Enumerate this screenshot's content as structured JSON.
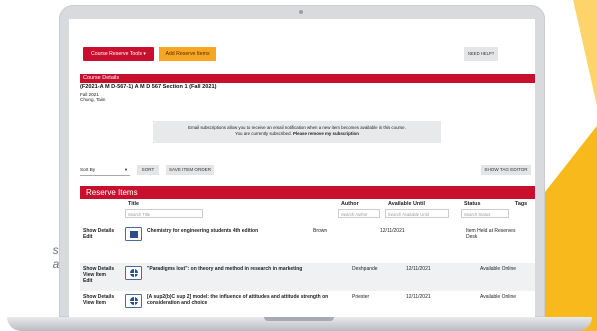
{
  "caption": {
    "line1": "serves",
    "line2": "anvas."
  },
  "toolbar": {
    "course_reserve_tools": "Course Reserve Tools ▾",
    "add_reserve_items": "Add Reserve Items",
    "need_help": "NEED HELP?"
  },
  "course": {
    "section_label": "Course Details",
    "title": "(F2021-A M D-567-1) A M D 567 Section 1 (Fall 2021)",
    "term": "Fall 2021",
    "instructor": "Chung, Taiin"
  },
  "notice": {
    "line1": "Email subscriptions allow you to receive an email notification when a new item becomes available in this course.",
    "line2_prefix": "You are currently subscribed.",
    "line2_link": "Please remove my subscription"
  },
  "controls": {
    "sort_by": "Sort By",
    "sort": "SORT",
    "save_order": "SAVE ITEM ORDER",
    "show_tag_editor": "SHOW TAG EDITOR"
  },
  "reserve": {
    "label": "Reserve Items",
    "headers": {
      "title": "Title",
      "author": "Author",
      "available_until": "Available Until",
      "status": "Status",
      "tags": "Tags"
    },
    "search": {
      "title": "Search Title",
      "author": "Search Author",
      "available_until": "Search Available Until",
      "status": "Search Status"
    },
    "rows": [
      {
        "action1": "Show Details",
        "action2": "Edit",
        "action3": "",
        "title": "Chemistry for engineering students 4th edition",
        "author": "Brown",
        "available_until": "12/11/2021",
        "status": "Item Held at Reserves Desk"
      },
      {
        "action1": "Show Details",
        "action2": "View Item",
        "action3": "Edit",
        "title": "\"Paradigms lost\": on theory and method in research in marketing",
        "author": "Deshpande",
        "available_until": "12/11/2021",
        "status": "Available Online"
      },
      {
        "action1": "Show Details",
        "action2": "View Item",
        "action3": "",
        "title": "[A sup2(b)C sup 2] model: the influence of attitudes and attitude strength on consideration and choice",
        "author": "Priester",
        "available_until": "12/11/2021",
        "status": "Available Online"
      }
    ]
  }
}
